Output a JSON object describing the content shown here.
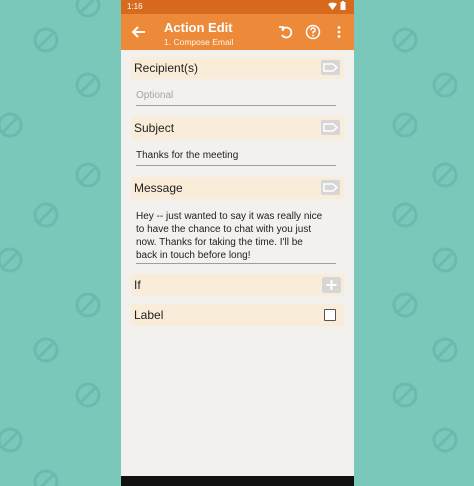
{
  "status_bar": {
    "time": "1:16"
  },
  "app_bar": {
    "title": "Action Edit",
    "subtitle": "1. Compose Email",
    "actions": [
      "back-icon",
      "undo-icon",
      "help-icon",
      "overflow-menu-icon"
    ],
    "color": "#ec8a3a"
  },
  "form": {
    "recipients": {
      "label": "Recipient(s)",
      "placeholder": "Optional",
      "value": ""
    },
    "subject": {
      "label": "Subject",
      "value": "Thanks for the meeting"
    },
    "message": {
      "label": "Message",
      "lines": [
        "Hey -- just wanted to say it was really nice",
        "to have the chance to chat with you just",
        "now. Thanks for taking the time. I'll be",
        "back in touch before long!"
      ]
    },
    "if": {
      "label": "If"
    },
    "label_row": {
      "label": "Label",
      "checked": false
    }
  },
  "colors": {
    "background": "#79c8ba",
    "header": "#f9ecd9",
    "status_bar": "#d86a1e"
  }
}
